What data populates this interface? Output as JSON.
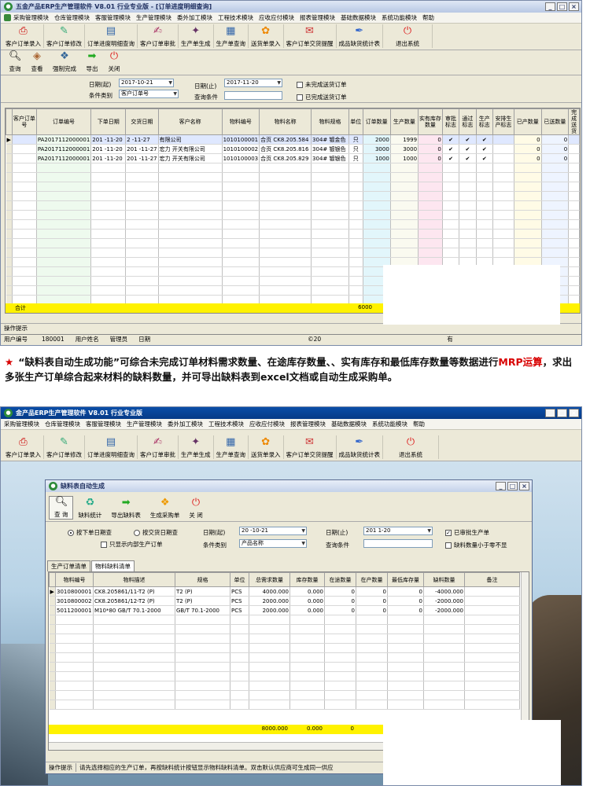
{
  "top": {
    "title": "五金产品ERP生产管理软件  V8.01  行业专业版 - [订单进度明细查询]",
    "menu": [
      "采购管理模块",
      "仓库管理模块",
      "客服管理模块",
      "生产管理模块",
      "委外加工模块",
      "工程技术模块",
      "应收应付模块",
      "报表管理模块",
      "基础数据模块",
      "系统功能模块",
      "帮助"
    ],
    "toolbar": [
      {
        "label": "客户订单录入",
        "icon": "pdf-icon"
      },
      {
        "label": "客户订单修改",
        "icon": "edit-doc-icon"
      },
      {
        "label": "订单进度明细查询",
        "icon": "query-doc-icon"
      },
      {
        "label": "客户订单审批",
        "icon": "approve-icon"
      },
      {
        "label": "生产单生成",
        "icon": "generate-icon"
      },
      {
        "label": "生产单查询",
        "icon": "search-doc-icon"
      },
      {
        "label": "送货单录入",
        "icon": "delivery-icon"
      },
      {
        "label": "客户订单交货提醒",
        "icon": "reminder-icon"
      },
      {
        "label": "成品缺货统计表",
        "icon": "stats-icon"
      },
      {
        "label": "退出系统",
        "icon": "exit-icon"
      }
    ],
    "subtoolbar": [
      {
        "label": "查询",
        "icon": "magnifier-icon"
      },
      {
        "label": "查看",
        "icon": "view-icon"
      },
      {
        "label": "强制完成",
        "icon": "force-complete-icon"
      },
      {
        "label": "导出",
        "icon": "export-arrow-icon"
      },
      {
        "label": "关闭",
        "icon": "close-power-icon"
      }
    ],
    "filter": {
      "date_from_label": "日期(起)",
      "date_from": "2017-10-21",
      "date_to_label": "日期(止)",
      "date_to": "2017-11-20",
      "cond_type_label": "条件类别",
      "cond_type": "客户订单号",
      "query_cond_label": "查询条件",
      "chk_unfinished_delivery": "未完成送货订单",
      "chk_finished_delivery": "已完成送货订单"
    },
    "columns": [
      "客户订单号",
      "订单编号",
      "下单日期",
      "交货日期",
      "客户名称",
      "物料编号",
      "物料名称",
      "物料规格",
      "单位",
      "订单数量",
      "生产数量",
      "实有库存数量",
      "审批标志",
      "通过标志",
      "生产标志",
      "安排生产标志",
      "已产数量",
      "已送数量",
      "完成送货"
    ],
    "rows": [
      [
        "",
        "PA2017112000001",
        "201 -11-20",
        "2  -11-27",
        "   有限公司",
        "1010100001",
        "合页 CK8.205.584",
        "304# 镀金色",
        "只",
        "2000",
        "1999",
        "0",
        "✔",
        "✔",
        "✔",
        "",
        "0",
        "0"
      ],
      [
        "",
        "PA2017112000001",
        "201 -11-20",
        "201 -11-27",
        "宏力   开关有限公司",
        "1010100002",
        "合页 CK8.205.816",
        "304# 镀银色",
        "只",
        "3000",
        "3000",
        "0",
        "✔",
        "✔",
        "✔",
        "",
        "0",
        "0"
      ],
      [
        "",
        "PA2017112000001",
        "201 -11-20",
        "201 -11-27",
        "宏力   开关有限公司",
        "1010100003",
        "合页 CK8.205.829",
        "304# 镀银色",
        "只",
        "1000",
        "1000",
        "0",
        "✔",
        "✔",
        "✔",
        "",
        "0",
        "0"
      ]
    ],
    "total_label": "合计",
    "total_qty": "6000",
    "hint_label": "操作提示",
    "status": {
      "user_id_label": "用户编号",
      "user_id": "180001",
      "user_name_label": "用户姓名",
      "user_name": "管理员",
      "date_label": "日期",
      "copyright": "©20",
      "rights": "有"
    }
  },
  "caption": {
    "star": "★",
    "part1": "“缺料表自动生成功能”可综合未完成订单材料需求数量、在途库存数量、、实有库存和最低库存数量等数据进行",
    "highlight": "MRP运算",
    "part2": "，求出多张生产订单综合起来材料的缺料数量，并可导出缺料表到excel文档或自动生成采购单。"
  },
  "bottom": {
    "title": "金产品ERP生产管理软件  V8.01  行业专业版",
    "menu": [
      "采购管理模块",
      "仓库管理模块",
      "客服管理模块",
      "生产管理模块",
      "委外加工模块",
      "工程技术模块",
      "应收应付模块",
      "报表管理模块",
      "基础数据模块",
      "系统功能模块",
      "帮助"
    ],
    "toolbar": [
      {
        "label": "客户订单录入",
        "icon": "pdf-icon"
      },
      {
        "label": "客户订单修改",
        "icon": "edit-doc-icon"
      },
      {
        "label": "订单进度明细查询",
        "icon": "query-doc-icon"
      },
      {
        "label": "客户订单审批",
        "icon": "approve-icon"
      },
      {
        "label": "生产单生成",
        "icon": "generate-icon"
      },
      {
        "label": "生产单查询",
        "icon": "search-doc-icon"
      },
      {
        "label": "送货单录入",
        "icon": "delivery-icon"
      },
      {
        "label": "客户订单交货提醒",
        "icon": "reminder-icon"
      },
      {
        "label": "成品缺货统计表",
        "icon": "stats-icon"
      },
      {
        "label": "退出系统",
        "icon": "exit-icon"
      }
    ],
    "sub": {
      "title": "缺料表自动生成",
      "toolbar": [
        {
          "label": "查 询",
          "icon": "magnifier-icon"
        },
        {
          "label": "缺料统计",
          "icon": "refresh-stats-icon"
        },
        {
          "label": "导出缺料表",
          "icon": "export-arrow-icon"
        },
        {
          "label": "生成采购单",
          "icon": "purchase-icon"
        },
        {
          "label": "关 闭",
          "icon": "close-power-icon"
        }
      ],
      "filter": {
        "radio_order_date": "按下单日期查",
        "radio_delivery_date": "按交货日期查",
        "chk_internal": "只显示内部生产订单",
        "date_from_label": "日期(起)",
        "date_from": "20  -10-21",
        "date_to_label": "日期(止)",
        "date_to": "201   1-20",
        "cond_type_label": "条件类别",
        "cond_type": "产品名称",
        "query_cond_label": "查询条件",
        "chk_approved": "已审批生产单",
        "chk_shortage_lt0": "缺料数量小于零不显"
      },
      "tabs": [
        "生产订单清单",
        "物料缺料清单"
      ],
      "columns": [
        "物料编号",
        "物料描述",
        "规格",
        "单位",
        "总需求数量",
        "库存数量",
        "在途数量",
        "在产数量",
        "最低库存量",
        "缺料数量",
        "备注"
      ],
      "rows": [
        [
          "3010800001",
          "CK8.205861/11-T2 (P)",
          "T2 (P)",
          "PCS",
          "4000.000",
          "0.000",
          "0",
          "0",
          "0",
          "-4000.000",
          ""
        ],
        [
          "3010800002",
          "CK8.205861/12-T2 (P)",
          "T2 (P)",
          "PCS",
          "2000.000",
          "0.000",
          "0",
          "0",
          "0",
          "-2000.000",
          ""
        ],
        [
          "5011200001",
          "M10*80 GB/T 70.1-2000",
          "GB/T 70.1-2000",
          "PCS",
          "2000.000",
          "0.000",
          "0",
          "0",
          "0",
          "-2000.000",
          ""
        ]
      ],
      "total_demand": "8000.000",
      "total_stock": "0.000",
      "total_transit": "0",
      "hint_label": "操作提示",
      "hint_text": "请先选择相应的生产订单，再按缺料统计按钮显示物料缺料清单。双击默认供应商可生成同一供应"
    }
  }
}
